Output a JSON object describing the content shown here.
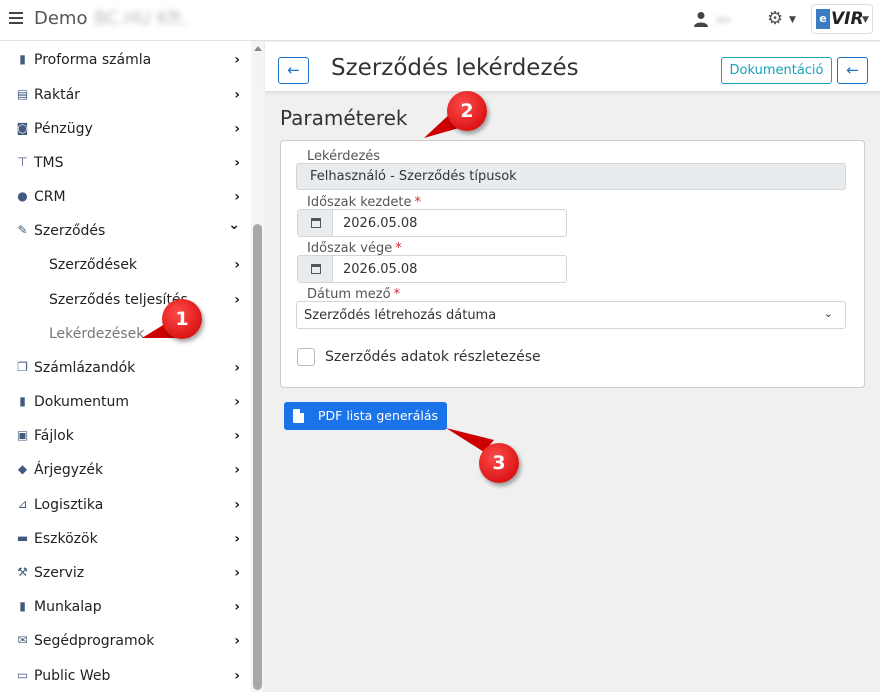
{
  "topbar": {
    "app_title": "Demo",
    "company_name": "BC.HU Kft.",
    "user_name": "ws",
    "logo_text": "VIR",
    "logo_badge": "e"
  },
  "sidebar": {
    "items": [
      {
        "label": "Proforma számla",
        "icon": "document-icon",
        "chev": "›"
      },
      {
        "label": "Raktár",
        "icon": "warehouse-icon",
        "chev": "›"
      },
      {
        "label": "Pénzügy",
        "icon": "money-icon",
        "chev": "›"
      },
      {
        "label": "TMS",
        "icon": "pin-icon",
        "chev": "›"
      },
      {
        "label": "CRM",
        "icon": "users-icon",
        "chev": "›"
      },
      {
        "label": "Szerződés",
        "icon": "contract-icon",
        "chev": "⌄"
      },
      {
        "label": "Szerződések",
        "icon": "",
        "chev": "›"
      },
      {
        "label": "Szerződés teljesítés",
        "icon": "",
        "chev": "›"
      },
      {
        "label": "Lekérdezések",
        "icon": "",
        "chev": ""
      },
      {
        "label": "Számlázandók",
        "icon": "copy-icon",
        "chev": "›"
      },
      {
        "label": "Dokumentum",
        "icon": "file-icon",
        "chev": "›"
      },
      {
        "label": "Fájlok",
        "icon": "file-image-icon",
        "chev": "›"
      },
      {
        "label": "Árjegyzék",
        "icon": "tags-icon",
        "chev": "›"
      },
      {
        "label": "Logisztika",
        "icon": "dolly-icon",
        "chev": "›"
      },
      {
        "label": "Eszközök",
        "icon": "toolbox-icon",
        "chev": "›"
      },
      {
        "label": "Szerviz",
        "icon": "wrench-icon",
        "chev": "›"
      },
      {
        "label": "Munkalap",
        "icon": "worksheet-icon",
        "chev": "›"
      },
      {
        "label": "Segédprogramok",
        "icon": "envelope-icon",
        "chev": "›"
      },
      {
        "label": "Public Web",
        "icon": "web-icon",
        "chev": "›"
      }
    ]
  },
  "header": {
    "title": "Szerződés lekérdezés",
    "doc_button": "Dokumentáció",
    "back_arrow": "←"
  },
  "params": {
    "section_title": "Paraméterek",
    "query_label": "Lekérdezés",
    "query_value": "Felhasználó - Szerződés típusok",
    "start_label": "Időszak kezdete",
    "start_value": "2026.05.08",
    "end_label": "Időszak vége",
    "end_value": "2026.05.08",
    "date_field_label": "Dátum mező",
    "date_field_value": "Szerződés létrehozás dátuma",
    "required_mark": "*",
    "detail_checkbox_label": "Szerződés adatok részletezése",
    "pdf_button": "PDF lista generálás"
  },
  "callouts": [
    "1",
    "2",
    "3"
  ],
  "colors": {
    "primary": "#1a73e8",
    "info": "#17a2b8",
    "callout": "#e00000",
    "nav_icon": "#415a7d"
  }
}
